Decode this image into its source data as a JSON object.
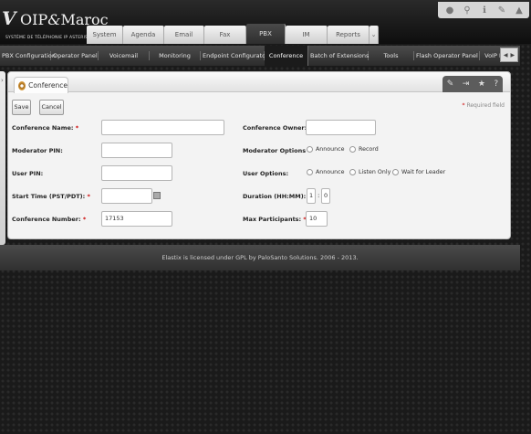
{
  "brand": {
    "name_part1": "OIP",
    "name_part2": "Maroc",
    "tagline": "SYSTÈME DE TÉLÉPHONIE IP ASTERISK"
  },
  "main_tabs": [
    {
      "label": "System"
    },
    {
      "label": "Agenda"
    },
    {
      "label": "Email"
    },
    {
      "label": "Fax"
    },
    {
      "label": "PBX"
    },
    {
      "label": "IM"
    },
    {
      "label": "Reports"
    }
  ],
  "sub_tabs": [
    {
      "label": "PBX Configuration"
    },
    {
      "label": "Operator Panel"
    },
    {
      "label": "Voicemail"
    },
    {
      "label": "Monitoring"
    },
    {
      "label": "Endpoint Configurator"
    },
    {
      "label": "Conference"
    },
    {
      "label": "Batch of Extensions"
    },
    {
      "label": "Tools"
    },
    {
      "label": "Flash Operator Panel"
    },
    {
      "label": "VoIP P"
    }
  ],
  "page": {
    "title": "Conference",
    "save_label": "Save",
    "cancel_label": "Cancel",
    "required_note": "Required field"
  },
  "form": {
    "conf_name_label": "Conference Name:",
    "conf_name_value": "",
    "conf_owner_label": "Conference Owner:",
    "conf_owner_value": "",
    "moderator_pin_label": "Moderator PIN:",
    "moderator_pin_value": "",
    "moderator_options_label": "Moderator Options",
    "mod_opt_announce": "Announce",
    "mod_opt_record": "Record",
    "user_pin_label": "User PIN:",
    "user_pin_value": "",
    "user_options_label": "User Options:",
    "user_opt_announce": "Announce",
    "user_opt_listen": "Listen Only",
    "user_opt_wait": "Wait for Leader",
    "start_time_label": "Start Time (PST/PDT):",
    "start_time_value": "",
    "duration_label": "Duration (HH:MM):",
    "duration_hours": "1",
    "duration_minutes": "0",
    "conf_number_label": "Conference Number:",
    "conf_number_value": "17153",
    "max_participants_label": "Max Participants:",
    "max_participants_value": "10"
  },
  "footer": {
    "text": "Elastix is licensed under GPL by PaloSanto Solutions. 2006 - 2013."
  }
}
